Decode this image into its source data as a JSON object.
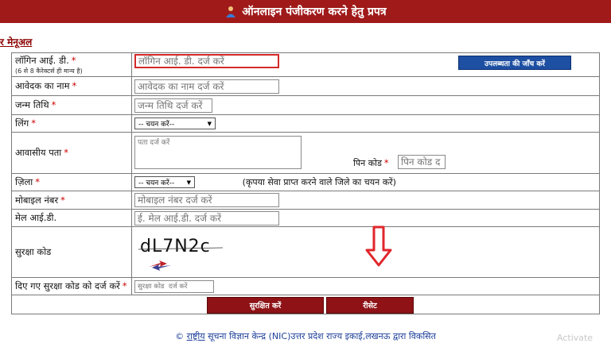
{
  "header": {
    "title": "ऑनलाइन पंजीकरण करने हेतु प्रपत्र",
    "logo_icon": "person-icon"
  },
  "manual_link": "र मेनूअल",
  "form": {
    "login_id": {
      "label": "लॉगिन आई. डी.",
      "note": "(6 से 8 कैरेक्टर्स ही मान्य है)",
      "placeholder": "लॉगिन आई. डी. दर्ज करें",
      "check_button": "उपलब्धता की जाँच करें"
    },
    "applicant_name": {
      "label": "आवेदक का नाम",
      "placeholder": "आवेदक का नाम दर्ज करें"
    },
    "dob": {
      "label": "जन्म तिथि",
      "placeholder": "जन्म तिथि दर्ज करें"
    },
    "gender": {
      "label": "लिंग",
      "selected": "-- चयन करें--"
    },
    "address": {
      "label": "आवासीय पता",
      "placeholder": "पता दर्ज करें"
    },
    "pincode": {
      "label": "पिन कोड",
      "placeholder": "पिन कोड द"
    },
    "district": {
      "label": "ज़िला",
      "selected": "-- चयन करें--",
      "hint": "(कृपया सेवा प्राप्त करने वाले जिले का चयन करें)"
    },
    "mobile": {
      "label": "मोबाइल नंबर",
      "placeholder": "मोबाइल नंबर दर्ज करें"
    },
    "email": {
      "label": "मेल आई.डी.",
      "placeholder": "ई. मेल आई.डी. दर्ज करें"
    },
    "captcha": {
      "label": "सुरक्षा कोड",
      "code": "dL7N2c"
    },
    "captcha_input": {
      "label": "दिए गए सुरक्षा कोड को दर्ज करें",
      "placeholder": "सुरक्षा कोड  दर्ज करें"
    },
    "save_button": "सुरक्षित करें",
    "reset_button": "रीसेट"
  },
  "required_mark": "*",
  "footer": {
    "prefix": "© ",
    "link": "राष्ट्रीय",
    "rest": " सूचना विज्ञान केन्द्र (NIC)उत्तर प्रदेश राज्य इकाई,लखनऊ द्वारा विकसित"
  },
  "watermark": "Activate"
}
